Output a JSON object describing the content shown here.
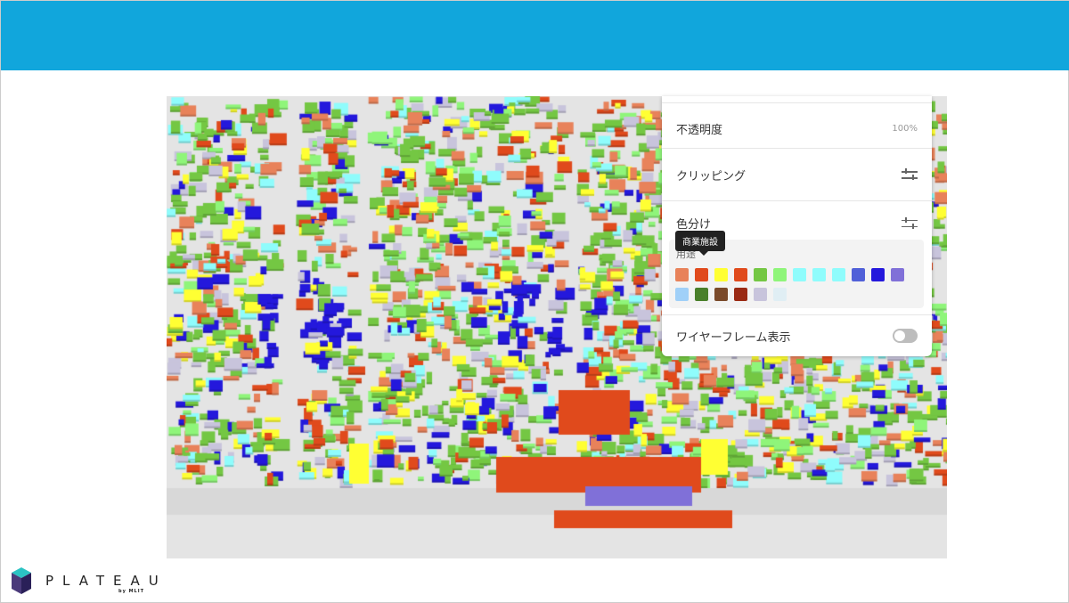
{
  "panel": {
    "opacity": {
      "label": "不透明度",
      "value": "100%"
    },
    "clipping": {
      "label": "クリッピング",
      "icon": "sliders-icon"
    },
    "color_by": {
      "label": "色分け",
      "icon": "sliders-icon"
    },
    "legend": {
      "label": "用途",
      "tooltip": "商業施設",
      "colors": [
        "#e8825a",
        "#e04a1c",
        "#ffff33",
        "#e04a1c",
        "#74c743",
        "#8ff57a",
        "#8ffcfc",
        "#8ffcfc",
        "#8ffcfc",
        "#5060d8",
        "#2418dc",
        "#8070d8",
        "#a0d0f8",
        "#4a7f2a",
        "#7a4a2a",
        "#9a2a14",
        "#c8c4dc",
        "#e0eef4"
      ]
    },
    "wireframe": {
      "label": "ワイヤーフレーム表示",
      "enabled": false
    }
  },
  "brand": {
    "name": "PLATEAU",
    "sub": "by MLIT"
  },
  "colors": {
    "header": "#11a6dc"
  }
}
